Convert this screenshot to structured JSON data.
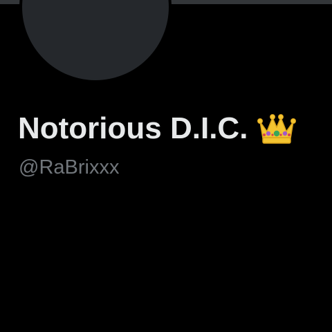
{
  "profile": {
    "display_name": "Notorious D.I.C.",
    "name_emoji_icon": "crown-icon",
    "handle": "@RaBrixxx"
  },
  "colors": {
    "background": "#000000",
    "banner": "#333639",
    "avatar_placeholder": "#25282c",
    "name_text": "#e7e9ea",
    "handle_text": "#71767b",
    "crown_gold": "#f4c430",
    "crown_gem_purple": "#a259c9",
    "crown_gem_green": "#3aa65a",
    "crown_gem_red": "#d9434b"
  }
}
